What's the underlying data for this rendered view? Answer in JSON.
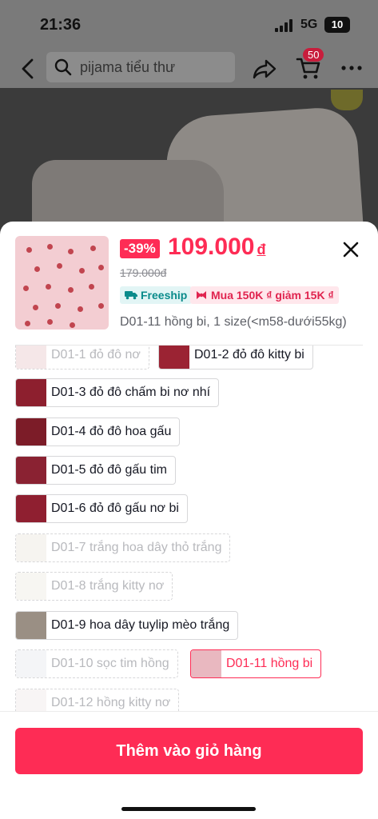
{
  "status": {
    "time": "21:36",
    "network": "5G",
    "battery": "10"
  },
  "nav": {
    "search_query": "pijama tiểu thư",
    "cart_count": "50"
  },
  "product": {
    "discount": "-39%",
    "price": "109.000",
    "currency": "đ",
    "original_price": "179.000đ",
    "tags": {
      "freeship": "Freeship",
      "promo": "Mua 150K ₫ giảm 15K ₫"
    },
    "selected_variant": "D01-11 hồng bi, 1 size(<m58-dưới55kg)"
  },
  "variants": [
    {
      "label": "D01-1 đỏ đô nơ",
      "state": "disabled",
      "swatch": "#e8c9cc"
    },
    {
      "label": "D01-2 đỏ đô kitty bi",
      "state": "available",
      "swatch": "#9b2333"
    },
    {
      "label": "D01-3 đỏ đô chấm bi nơ nhí",
      "state": "available",
      "swatch": "#8d1f2e"
    },
    {
      "label": "D01-4 đỏ đô hoa gấu",
      "state": "available",
      "swatch": "#7c1c28"
    },
    {
      "label": "D01-5 đỏ đô gấu tim",
      "state": "available",
      "swatch": "#8a2232"
    },
    {
      "label": "D01-6 đỏ đô gấu nơ bi",
      "state": "available",
      "swatch": "#8f1f30"
    },
    {
      "label": "D01-7 trắng hoa dây thỏ trắng",
      "state": "disabled",
      "swatch": "#ece6de"
    },
    {
      "label": "D01-8 trắng kitty nơ",
      "state": "disabled",
      "swatch": "#eeeae3"
    },
    {
      "label": "D01-9 hoa dây tuylip mèo trắng",
      "state": "available",
      "swatch": "#9a8f84"
    },
    {
      "label": "D01-10 sọc tim hồng",
      "state": "disabled",
      "swatch": "#e7e9ee"
    },
    {
      "label": "D01-11 hồng bi",
      "state": "selected",
      "swatch": "#e9b8c0"
    },
    {
      "label": "D01-12 hồng kitty nơ",
      "state": "disabled",
      "swatch": "#f0e8e8"
    }
  ],
  "cta": {
    "add_to_cart": "Thêm vào giỏ hàng"
  },
  "colors": {
    "accent": "#fe2c55",
    "freeship_bg": "#e2f5f5",
    "freeship_text": "#0a8b8b",
    "promo_bg": "#ffe7ec"
  }
}
